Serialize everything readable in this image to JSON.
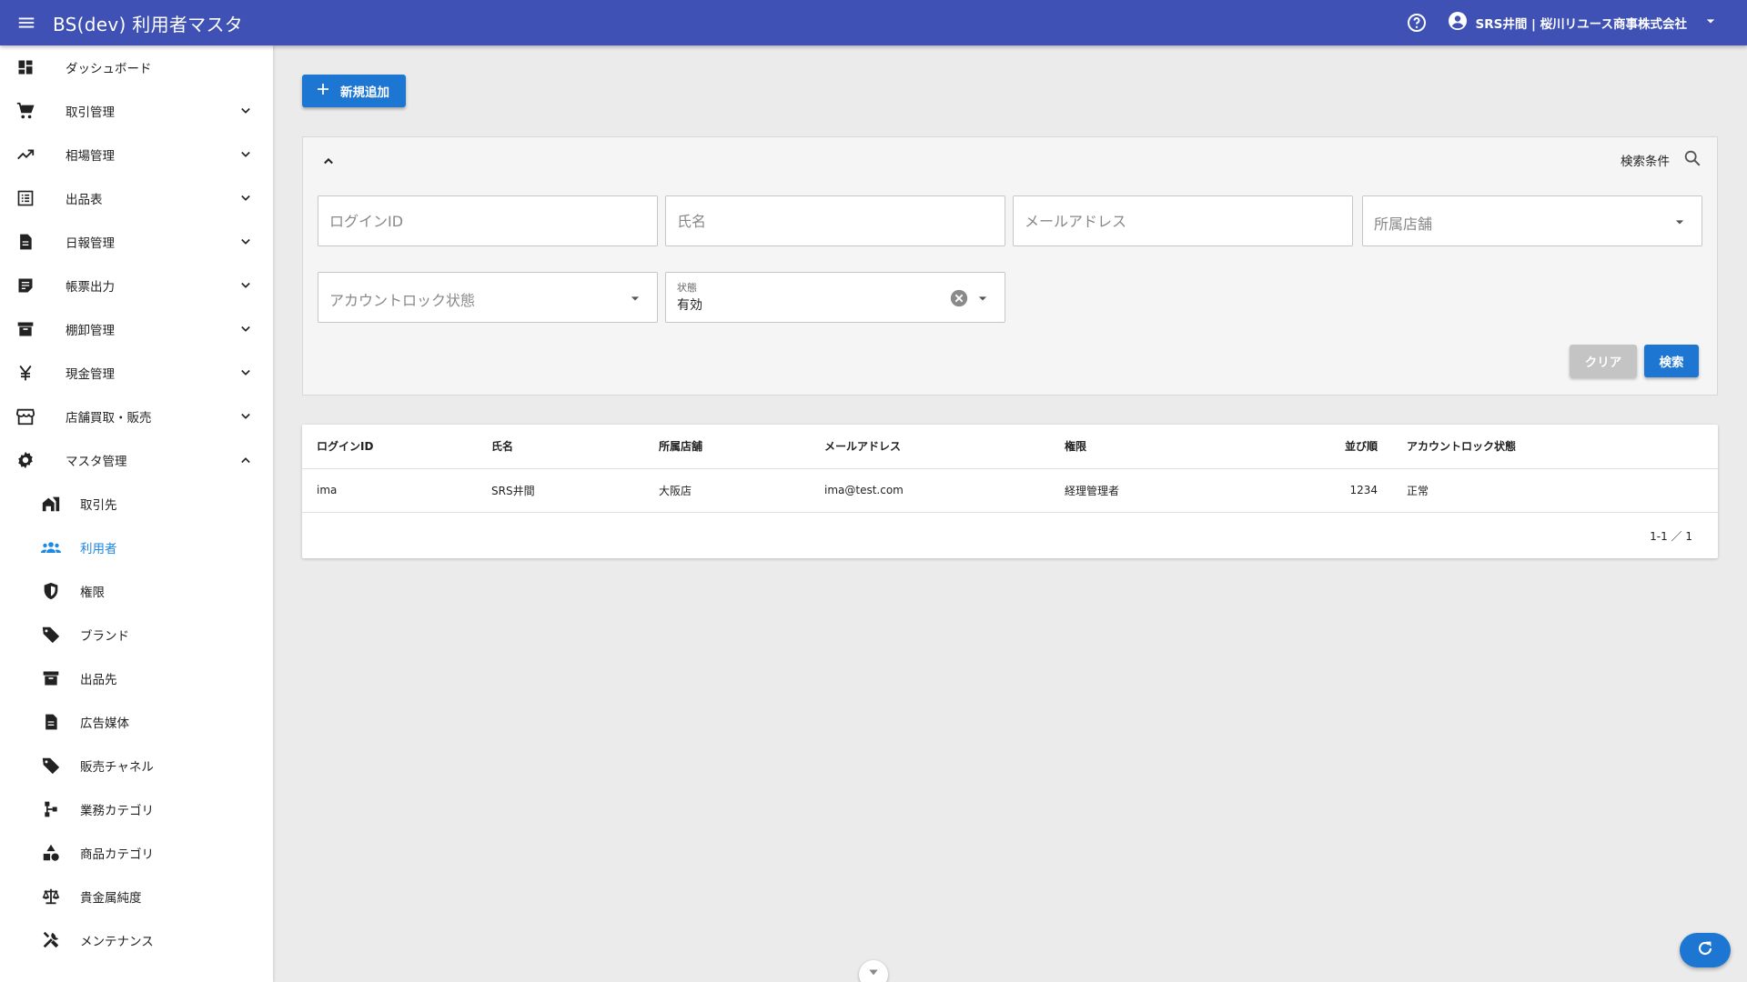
{
  "appbar": {
    "title": "BS(dev) 利用者マスタ",
    "user_name": "SRS井間 | 桜川リユース商事株式会社"
  },
  "sidebar": {
    "items": [
      {
        "label": "ダッシュボード",
        "icon": "dashboard-icon"
      },
      {
        "label": "取引管理",
        "icon": "cart-icon"
      },
      {
        "label": "相場管理",
        "icon": "trending-up-icon"
      },
      {
        "label": "出品表",
        "icon": "list-icon"
      },
      {
        "label": "日報管理",
        "icon": "document-icon"
      },
      {
        "label": "帳票出力",
        "icon": "note-icon"
      },
      {
        "label": "棚卸管理",
        "icon": "archive-icon"
      },
      {
        "label": "現金管理",
        "icon": "yen-icon"
      },
      {
        "label": "店舗買取・販売",
        "icon": "store-icon"
      },
      {
        "label": "マスタ管理",
        "icon": "gear-icon"
      }
    ],
    "sub_items": [
      {
        "label": "取引先",
        "icon": "client-icon"
      },
      {
        "label": "利用者",
        "icon": "people-icon"
      },
      {
        "label": "権限",
        "icon": "shield-icon"
      },
      {
        "label": "ブランド",
        "icon": "tag-icon"
      },
      {
        "label": "出品先",
        "icon": "archive-icon"
      },
      {
        "label": "広告媒体",
        "icon": "document-icon"
      },
      {
        "label": "販売チャネル",
        "icon": "tag-icon"
      },
      {
        "label": "業務カテゴリ",
        "icon": "tree-icon"
      },
      {
        "label": "商品カテゴリ",
        "icon": "category-icon"
      },
      {
        "label": "貴金属純度",
        "icon": "scale-icon"
      },
      {
        "label": "メンテナンス",
        "icon": "tools-icon"
      }
    ],
    "active_color": "#1e88e5"
  },
  "toolbar": {
    "add_label": "新規追加"
  },
  "search": {
    "title": "検索条件",
    "login_id_placeholder": "ログインID",
    "name_placeholder": "氏名",
    "email_placeholder": "メールアドレス",
    "store_placeholder": "所属店舗",
    "lock_placeholder": "アカウントロック状態",
    "status_label": "状態",
    "status_value": "有効",
    "clear_label": "クリア",
    "search_label": "検索"
  },
  "table": {
    "headers": [
      "ログインID",
      "氏名",
      "所属店舗",
      "メールアドレス",
      "権限",
      "並び順",
      "アカウントロック状態"
    ],
    "rows": [
      [
        "ima",
        "SRS井間",
        "大阪店",
        "ima@test.com",
        "経理管理者",
        "1234",
        "正常"
      ]
    ],
    "pagination": "1-1 ／ 1"
  },
  "colors": {
    "appbar": "#3f51b5",
    "primary_button": "#1e76d3",
    "disabled_button": "#c4c4c4"
  }
}
